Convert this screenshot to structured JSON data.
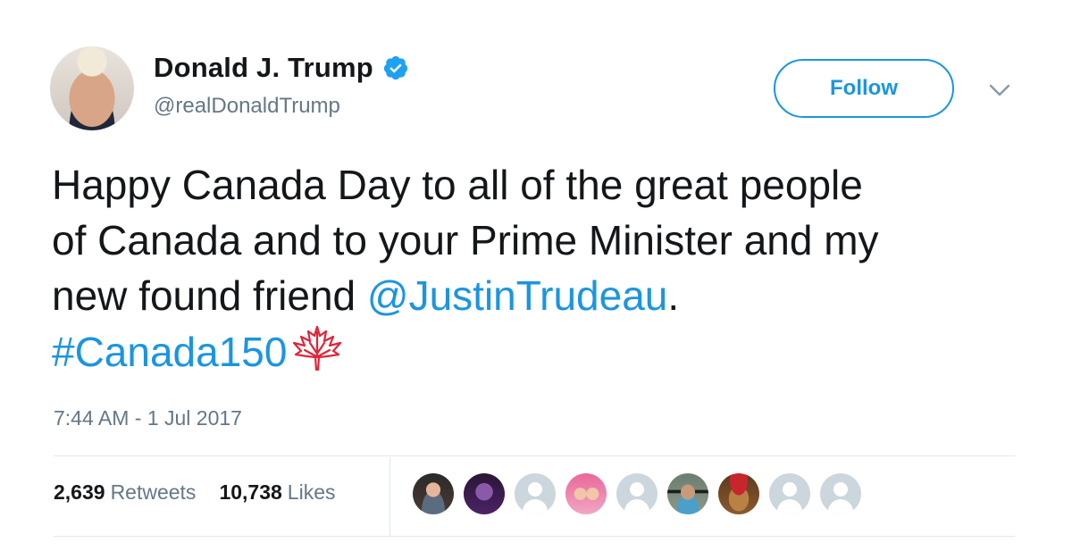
{
  "author": {
    "name": "Donald J. Trump",
    "handle": "@realDonaldTrump",
    "verified_icon": "verified-badge-icon"
  },
  "follow_button": {
    "label": "Follow"
  },
  "menu_icon": "chevron-down-icon",
  "tweet": {
    "line1": "Happy Canada Day to all of the great people",
    "line2": "of Canada and to your Prime Minister and my",
    "line3_prefix": "new found friend ",
    "mention": "@JustinTrudeau",
    "line3_suffix": ".",
    "hashtag": "#Canada150",
    "emoji_icon": "maple-leaf-icon"
  },
  "timestamp": "7:44 AM - 1 Jul 2017",
  "stats": {
    "retweets_count": "2,639",
    "retweets_label": "Retweets",
    "likes_count": "10,738",
    "likes_label": "Likes"
  },
  "likers": [
    "photo",
    "photo",
    "default",
    "photo",
    "default",
    "photo",
    "photo",
    "default",
    "default"
  ],
  "colors": {
    "accent": "#1b95e0",
    "text": "#14171a",
    "muted": "#657786",
    "divider": "#e1e8ed",
    "maple": "#e0243a"
  }
}
